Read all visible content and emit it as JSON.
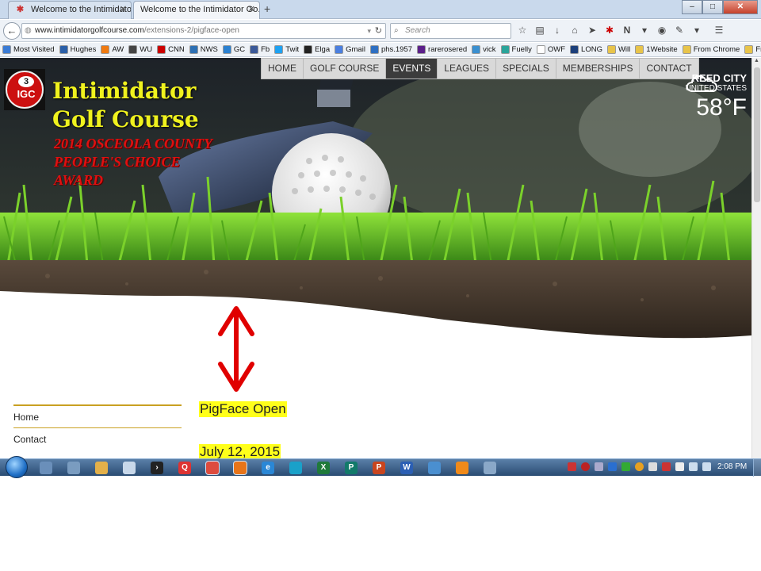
{
  "browser": {
    "tabs": [
      {
        "label": "Welcome to the Intimidato...",
        "icon": "puzzle-icon"
      },
      {
        "label": "Welcome to the Intimidator Go...",
        "icon": "none"
      }
    ],
    "new_tab_label": "+",
    "window_buttons": {
      "minimize": "–",
      "maximize": "□",
      "close": "✕"
    },
    "url_host": "www.intimidatorgolfcourse.com",
    "url_path": "/extensions-2/pigface-open",
    "search_placeholder": "Search",
    "bookmarks": [
      {
        "label": "Most Visited",
        "color": "#3a7bd5"
      },
      {
        "label": "Hughes",
        "color": "#2a5fa8"
      },
      {
        "label": "AW",
        "color": "#f07a10"
      },
      {
        "label": "WU",
        "color": "#444444"
      },
      {
        "label": "CNN",
        "color": "#cc0000"
      },
      {
        "label": "NWS",
        "color": "#2c6fb3"
      },
      {
        "label": "GC",
        "color": "#2a80d0"
      },
      {
        "label": "Fb",
        "color": "#3b5998"
      },
      {
        "label": "Twit",
        "color": "#1da1f2"
      },
      {
        "label": "Elga",
        "color": "#222222"
      },
      {
        "label": "Gmail",
        "color": "#4a7fe0"
      },
      {
        "label": "phs.1957",
        "color": "#2e6fc2"
      },
      {
        "label": "rarerosered",
        "color": "#5b1f8a"
      },
      {
        "label": "vick",
        "color": "#3a8fd0"
      },
      {
        "label": "Fuelly",
        "color": "#2aa49a"
      },
      {
        "label": "OWF",
        "color": "#ffffff"
      },
      {
        "label": "LONG",
        "color": "#1c3f7a"
      },
      {
        "label": "Will",
        "color": "#e8c44a"
      },
      {
        "label": "1Website",
        "color": "#e8c44a"
      },
      {
        "label": "From Chrome",
        "color": "#e8c44a"
      },
      {
        "label": "From IE",
        "color": "#e8c44a"
      }
    ]
  },
  "site": {
    "nav": [
      "HOME",
      "GOLF COURSE",
      "EVENTS",
      "LEAGUES",
      "SPECIALS",
      "MEMBERSHIPS",
      "CONTACT"
    ],
    "active_nav": "EVENTS",
    "logo_number": "3",
    "logo_text": "IGC",
    "title_line1": "Intimidator",
    "title_line2": "Golf Course",
    "award_text": "2014 OSCEOLA COUNTY PEOPLE'S CHOICE AWARD",
    "weather": {
      "city": "REED CITY",
      "country": "UNITED STATES",
      "temp": "58°F",
      "icon": "cloud-icon"
    },
    "sidebar": [
      "Home",
      "Contact"
    ],
    "event_title": "PigFace Open",
    "event_date": "July 12, 2015"
  },
  "taskbar": {
    "clock": "2:08 PM"
  },
  "colors": {
    "title_yellow": "#f0f21e",
    "award_red": "#e01010",
    "highlight": "#ffff1a",
    "sidebar_line": "#c9a022",
    "arrow_red": "#e00000"
  }
}
